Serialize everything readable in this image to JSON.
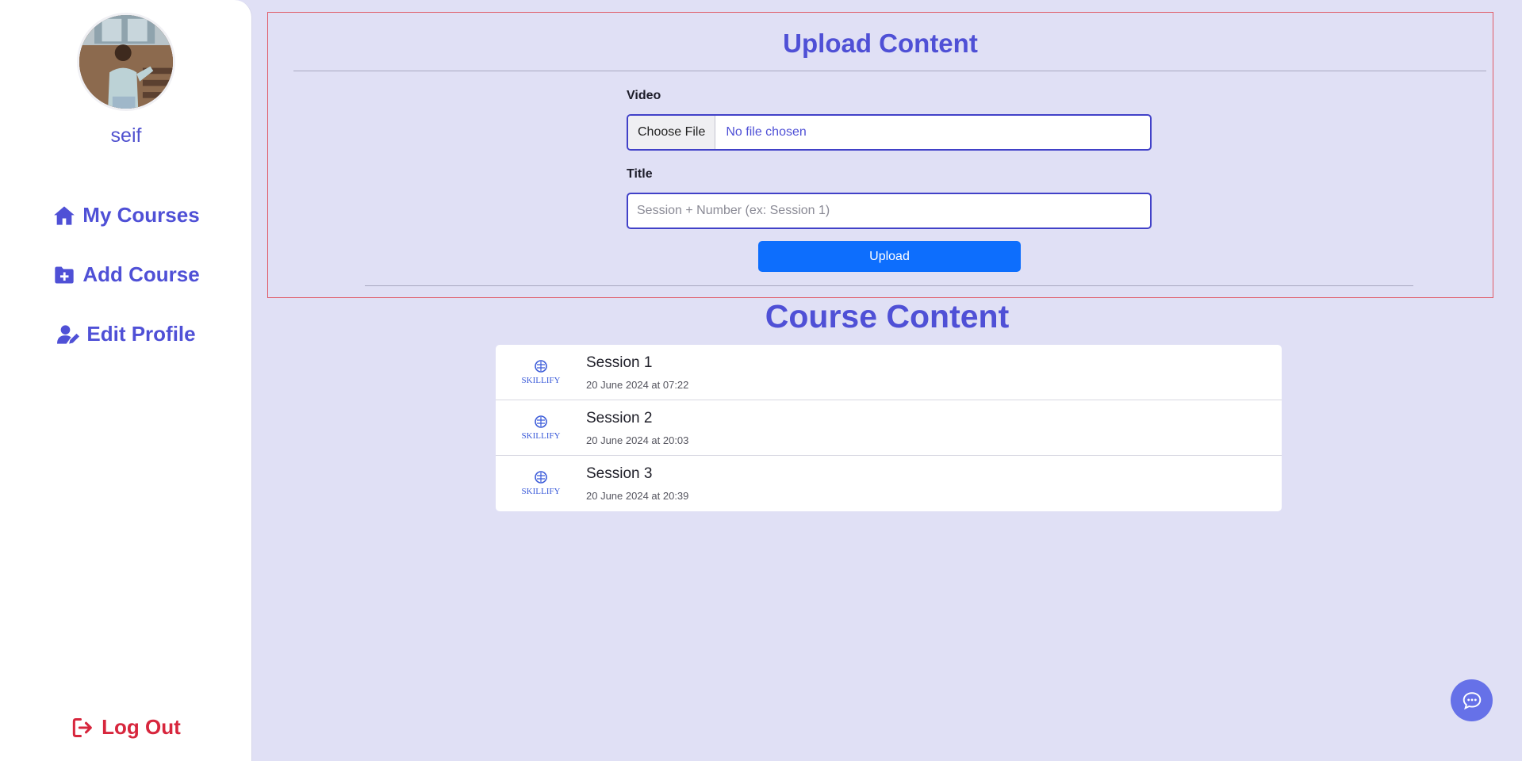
{
  "sidebar": {
    "username": "seif",
    "nav": [
      {
        "label": "My Courses",
        "icon": "home-icon"
      },
      {
        "label": "Add Course",
        "icon": "folder-plus-icon"
      },
      {
        "label": "Edit Profile",
        "icon": "user-edit-icon"
      }
    ],
    "logout": {
      "label": "Log Out",
      "icon": "logout-icon"
    }
  },
  "upload": {
    "title": "Upload Content",
    "video_label": "Video",
    "file_button": "Choose File",
    "file_status": "No file chosen",
    "title_label": "Title",
    "title_placeholder": "Session + Number (ex: Session 1)",
    "submit": "Upload"
  },
  "content": {
    "title": "Course Content",
    "logo_text": "SKILLIFY",
    "sessions": [
      {
        "name": "Session 1",
        "date": "20 June 2024 at 07:22"
      },
      {
        "name": "Session 2",
        "date": "20 June 2024 at 20:03"
      },
      {
        "name": "Session 3",
        "date": "20 June 2024 at 20:39"
      }
    ]
  },
  "colors": {
    "accent": "#4f50d6",
    "background": "#e0e0f5",
    "upload_button": "#0d6efd",
    "logout": "#d7263d",
    "panel_border": "#e05a66",
    "chat_button": "#6671e8"
  },
  "chat": {
    "icon": "chat-bubble-icon"
  }
}
